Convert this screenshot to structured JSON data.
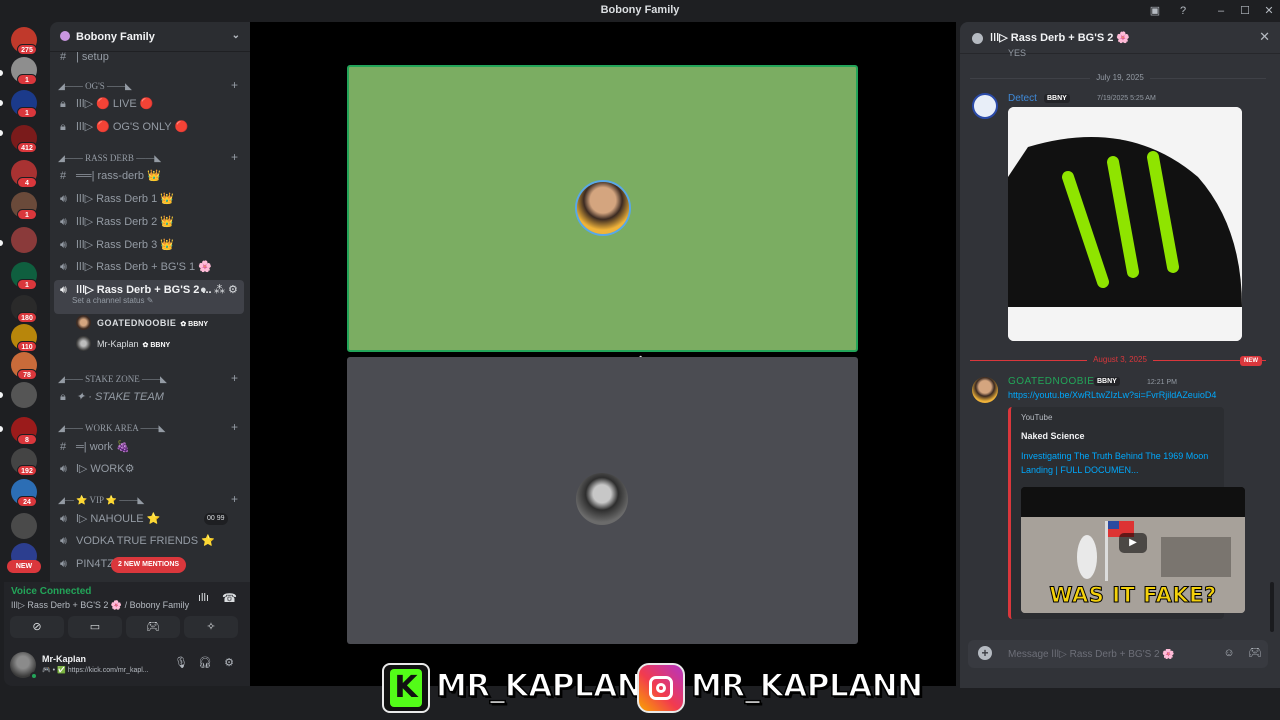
{
  "window": {
    "title": "Bobony Family"
  },
  "rail": {
    "badges": [
      "275",
      "1",
      "1",
      "412",
      "4",
      "1",
      "1",
      "180",
      "110",
      "78",
      "8",
      "192",
      "24"
    ],
    "new_label": "NEW",
    "server_colors": [
      "#c0392b",
      "#8e8e8e",
      "#1b3a8a",
      "#7a1b1b",
      "#a83232",
      "#6a4a3a",
      "#8a3a3a",
      "#0f5f3f",
      "#2a2a2a",
      "#b8860b",
      "#c96b3a",
      "#555555",
      "#9b1b1b",
      "#444444",
      "#2c6eb5",
      "#4a4a4a",
      "#2c3e8f"
    ]
  },
  "sidebar": {
    "guild_name": "Bobony Family",
    "setup_channel": "| setup",
    "categories": {
      "ogs": "◢—— OG'S ——◣",
      "rass": "◢—— RASS DERB ——◣",
      "stake": "◢—— STAKE ZONE ——◣",
      "work": "◢—— WORK AREA ——◣",
      "vip": "◢— ⭐ VIP ⭐ ——◣"
    },
    "channels": {
      "live": "ǀǀǀ▷ 🔴 LIVE 🔴",
      "og_only": "ǀǀǀ▷ 🔴 OG'S ONLY 🔴",
      "rass_text": "══| rass-derb 👑",
      "rass1": "ǀǀǀ▷ Rass Derb 1 👑",
      "rass2": "ǀǀǀ▷ Rass Derb 2 👑",
      "rass3": "ǀǀǀ▷ Rass Derb 3 👑",
      "rass_bg1": "ǀǀǀ▷ Rass Derb + BG'S 1 🌸",
      "rass_bg2": "ǀǀǀ▷ Rass Derb + BG'S 2 ...",
      "rass_bg2_status": "Set a channel status ✎",
      "stake_team": "✦ · STAKE TEAM",
      "work_text": "═| work 🍇",
      "work_voice": "ǀ▷ WORK⚙",
      "nahoule": "ǀ▷ NAHOULE ⭐",
      "vodka": "VODKA TRUE FRIENDS ⭐",
      "pin4tz": "PIN4TZ"
    },
    "nahoule_counts": [
      "00",
      "99"
    ],
    "members": [
      {
        "name": "GOATEDNOOBIE",
        "tag": "BBNY"
      },
      {
        "name": "Mr-Kaplan",
        "tag": "BBNY"
      }
    ],
    "mentions_badge": "2 NEW MENTIONS"
  },
  "voice_panel": {
    "status": "Voice Connected",
    "channel": "ǀǀǀ▷ Rass Derb + BG'S 2 🌸 / Bobony Family"
  },
  "user_panel": {
    "name": "Mr-Kaplan",
    "sub": "🎮 • ✅ https://kick.com/mr_kapl..."
  },
  "chat": {
    "title": "ǀǀǀ▷ Rass Derb + BG'S 2 🌸",
    "prev_text": "YES",
    "date1": "July 19, 2025",
    "msg1": {
      "author": "Detect",
      "tag": "BBNY",
      "time": "7/19/2025 5:25 AM"
    },
    "date2": "August 3, 2025",
    "new_label": "NEW",
    "msg2": {
      "author": "GOATEDNOOBIE",
      "tag": "BBNY",
      "time": "12:21 PM",
      "link": "https://youtu.be/XwRLtwZIzLw?si=FvrRjildAZeuioD4"
    },
    "embed": {
      "site": "YouTube",
      "author": "Naked Science",
      "title": "Investigating The Truth Behind The 1969 Moon Landing | FULL DOCUMEN...",
      "thumb_text": "WAS IT FAKE?"
    },
    "composer_placeholder": "Message ǀǀǀ▷ Rass Derb + BG'S 2 🌸"
  },
  "overlay": {
    "kick_handle": "MR_KAPLANN",
    "ig_handle": "MR_KAPLANN"
  },
  "colors": {
    "accent_green": "#23a559",
    "tile_green": "#7bad62",
    "danger": "#da373c",
    "link": "#00a8fc"
  }
}
